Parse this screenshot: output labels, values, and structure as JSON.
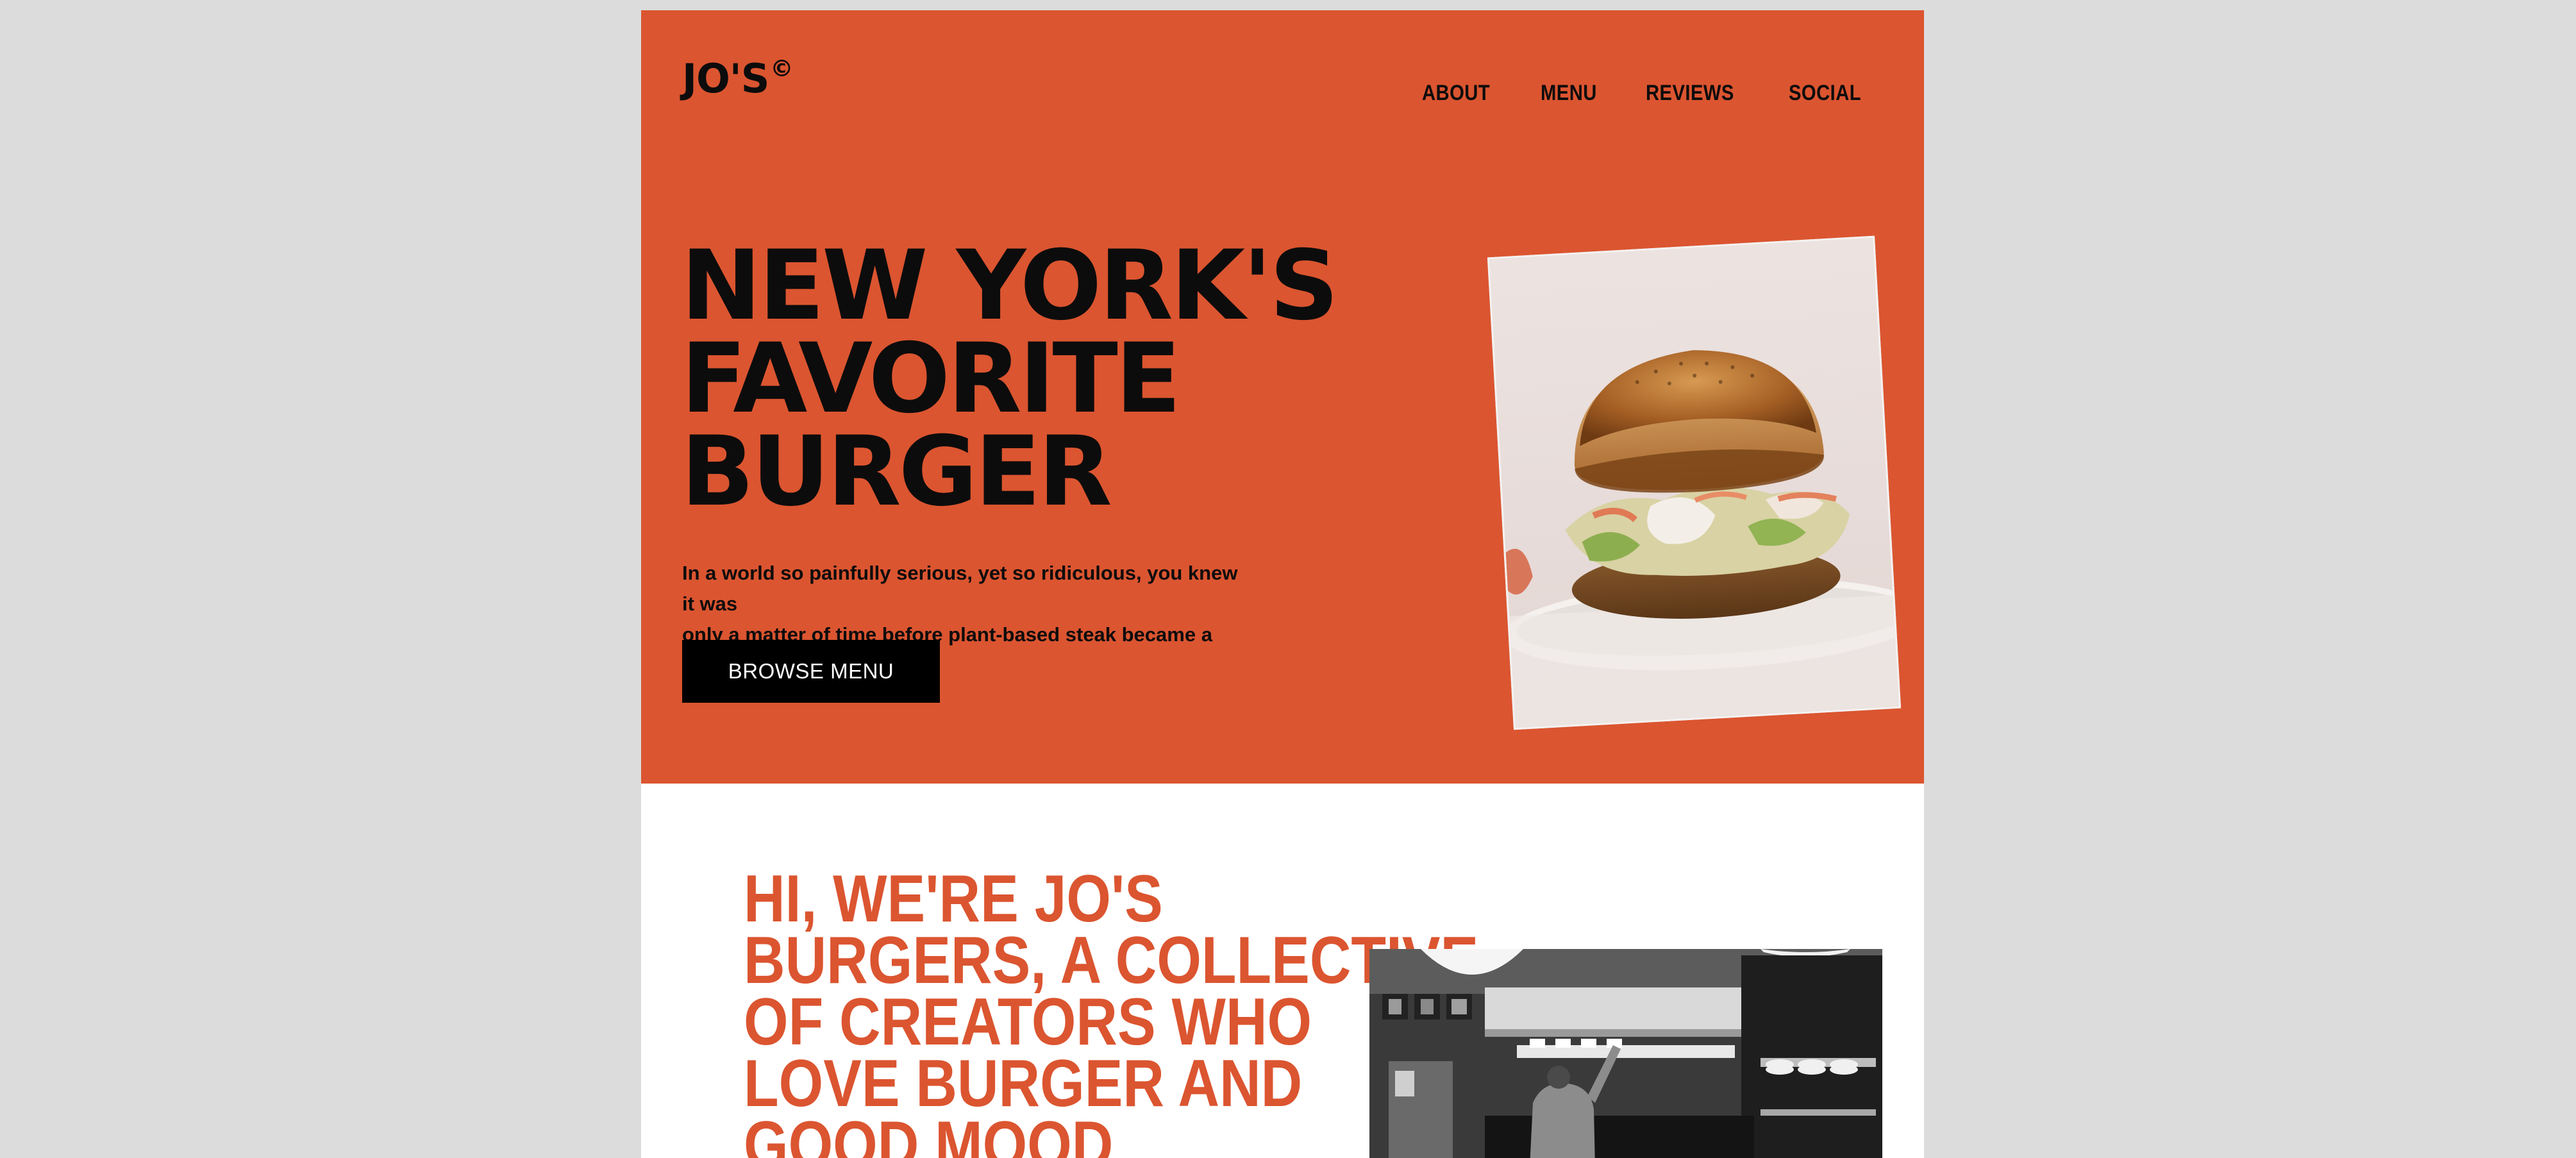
{
  "brand": {
    "logo_text": "JO'S",
    "logo_mark": "©",
    "accent_color": "#db5530"
  },
  "nav": {
    "items": [
      {
        "label": "ABOUT"
      },
      {
        "label": "MENU"
      },
      {
        "label": "REVIEWS"
      },
      {
        "label": "SOCIAL"
      }
    ]
  },
  "hero": {
    "headline": [
      "NEW YORK'S",
      "FAVORITE",
      "BURGER"
    ],
    "tagline_lines": [
      "In a world so painfully serious, yet so ridiculous, you knew it was",
      "only a matter of time before plant-based steak became a thing."
    ],
    "cta_label": "BROWSE MENU",
    "photo_icon": "burger-photo"
  },
  "about": {
    "heading": [
      "HI, WE'RE JO'S",
      "BURGERS, A COLLECTIVE",
      "OF CREATORS WHO",
      "LOVE BURGER AND",
      "GOOD MOOD"
    ],
    "photo_icon": "kitchen-photo"
  }
}
